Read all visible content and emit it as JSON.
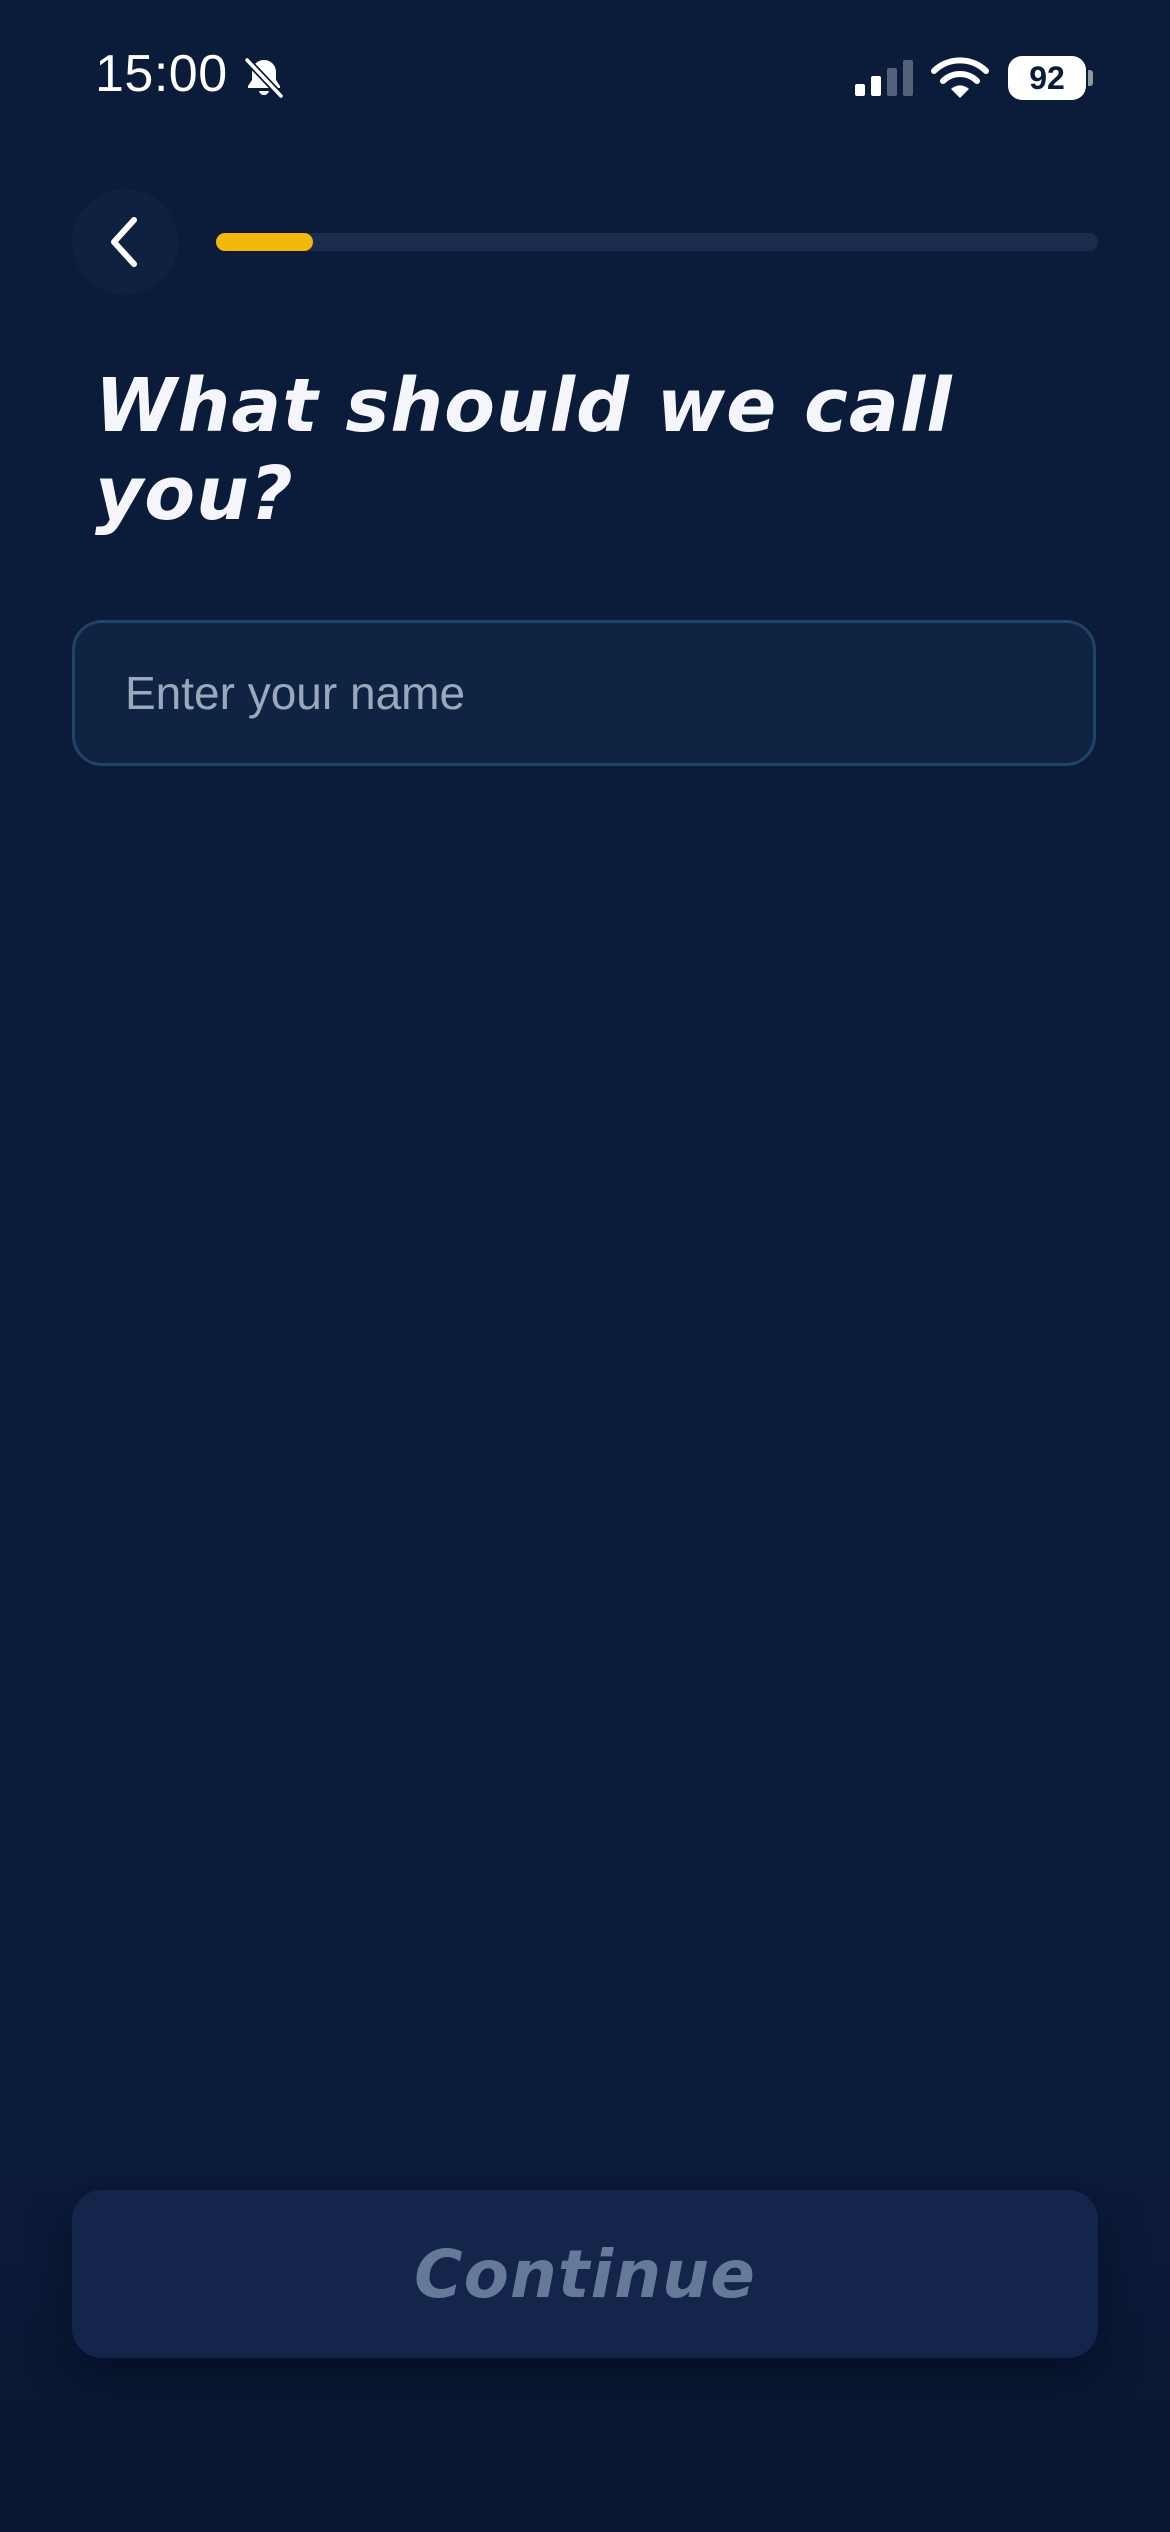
{
  "status_bar": {
    "time": "15:00",
    "battery_percent": "92",
    "icons": [
      "bell-slash-icon",
      "cellular-signal-icon",
      "wifi-icon",
      "battery-icon"
    ],
    "signal_bars_active": 2,
    "signal_bars_total": 4
  },
  "header": {
    "back_icon": "chevron-left-icon",
    "progress_fraction": 0.11,
    "progress_color": "#f2b90c"
  },
  "main": {
    "title": "What should we call you?",
    "name_input": {
      "value": "",
      "placeholder": "Enter your name"
    }
  },
  "footer": {
    "continue_label": "Continue",
    "continue_enabled": false
  },
  "colors": {
    "background": "#0b1b3a",
    "accent": "#f2b90c",
    "input_border": "#1f4467",
    "button_disabled_text": "#647a98"
  }
}
